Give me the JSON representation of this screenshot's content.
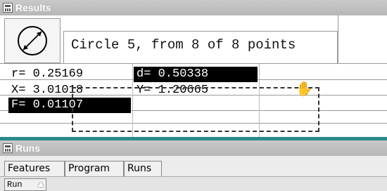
{
  "results_panel": {
    "title": "Results",
    "header": {
      "symbol_icon": "circle-diameter-icon",
      "title": "Circle 5, from 8 of 8 points"
    },
    "rows": [
      [
        {
          "text": "r= 0.25169",
          "selected": false
        },
        {
          "text": "d= 0.50338",
          "selected": true
        },
        {
          "text": "",
          "selected": false
        }
      ],
      [
        {
          "text": "X= 3.01018",
          "selected": false
        },
        {
          "text": "Y= 1.20665",
          "selected": false
        },
        {
          "text": "",
          "selected": false
        }
      ],
      [
        {
          "text": "F= 0.01107",
          "selected": true
        },
        {
          "text": "",
          "selected": false
        },
        {
          "text": "",
          "selected": false
        }
      ]
    ],
    "cursor_icon": "hand-grab-icon"
  },
  "runs_panel": {
    "title": "Runs",
    "tabs": [
      "Features",
      "Program",
      "Runs"
    ],
    "column_header": "Run"
  }
}
